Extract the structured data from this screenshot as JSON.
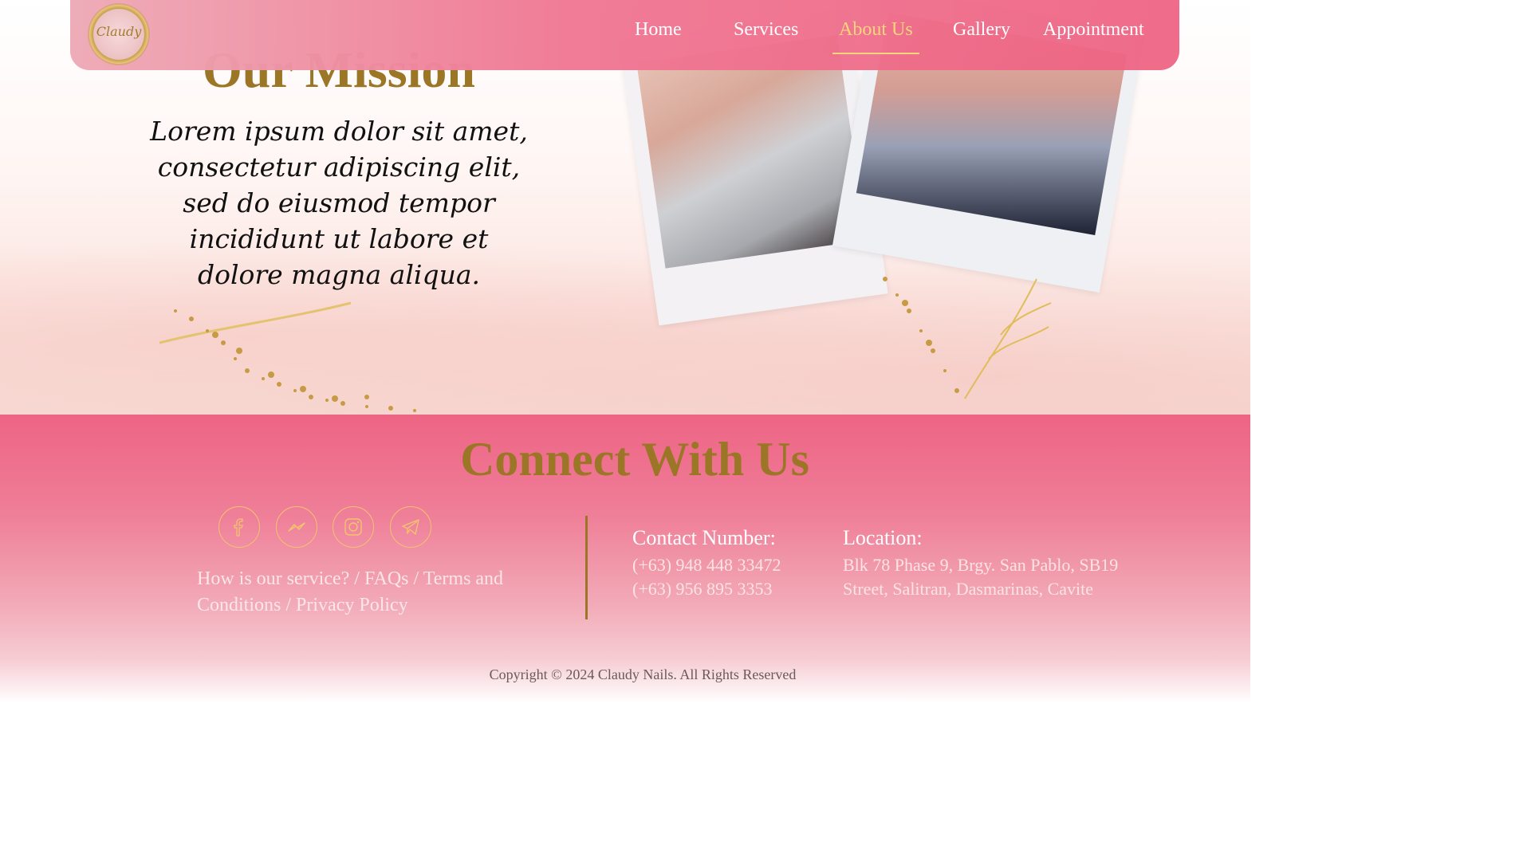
{
  "nav": {
    "logo_text": "Claudy",
    "items": [
      {
        "label": "Home"
      },
      {
        "label": "Services"
      },
      {
        "label": "About Us",
        "active": true
      },
      {
        "label": "Gallery"
      },
      {
        "label": "Appointment"
      }
    ],
    "active_color": "#f7d57c"
  },
  "mission": {
    "title": "Our Mission",
    "text": "Lorem ipsum dolor sit amet, consectetur adipiscing elit, sed do eiusmod tempor incididunt ut labore et dolore magna aliqua."
  },
  "footer": {
    "title": "Connect With Us",
    "social": [
      "facebook-icon",
      "messenger-icon",
      "instagram-icon",
      "telegram-icon"
    ],
    "links": [
      "How is our service?",
      "FAQs",
      "Terms and Conditions",
      "Privacy Policy"
    ],
    "link_separator": " / ",
    "contact": {
      "label": "Contact Number:",
      "numbers": [
        "(+63) 948 448 33472",
        "(+63) 956 895 3353"
      ]
    },
    "location": {
      "label": "Location:",
      "lines": [
        "Blk 78 Phase 9, Brgy. San Pablo, SB19",
        "Street, Salitran, Dasmarinas, Cavite"
      ]
    },
    "copyright": "Copyright © 2024 Claudy Nails. All Rights Reserved"
  },
  "colors": {
    "gold": "#9b7626",
    "pink": "#ee6485",
    "icon_outline": "#f2c46c"
  }
}
